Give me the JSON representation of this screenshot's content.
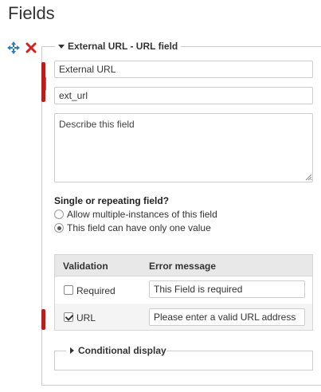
{
  "page": {
    "title": "Fields"
  },
  "icons": {
    "move": "move-icon",
    "delete": "delete-icon"
  },
  "colors": {
    "delete": "#d62020",
    "move": "#2a7bc0",
    "annotation": "#b81e1e"
  },
  "field": {
    "legend": "External URL - URL field",
    "label_value": "External URL",
    "name_value": "ext_url",
    "description_placeholder": "Describe this field",
    "repeat_question": "Single or repeating field?",
    "repeat_options": [
      {
        "label": "Allow multiple-instances of this field",
        "selected": false
      },
      {
        "label": "This field can have only one value",
        "selected": true
      }
    ],
    "validation": {
      "headers": {
        "validation": "Validation",
        "error": "Error message"
      },
      "rows": [
        {
          "label": "Required",
          "checked": false,
          "error": "This Field is required"
        },
        {
          "label": "URL",
          "checked": true,
          "error": "Please enter a valid URL address"
        }
      ]
    },
    "conditional_legend": "Conditional display"
  }
}
